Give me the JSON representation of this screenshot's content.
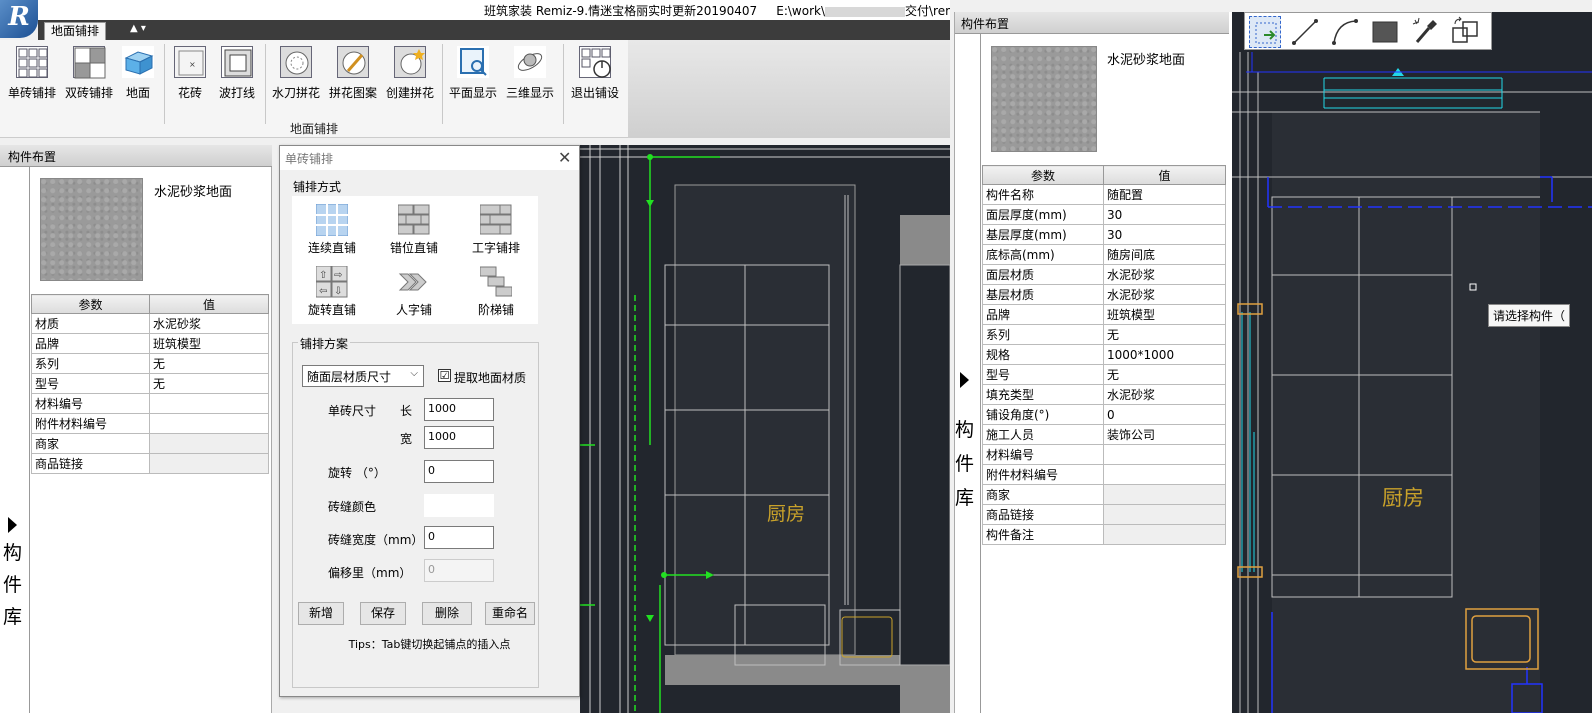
{
  "window": {
    "title_left": "班筑家装 Remiz-9.情迷宝格丽实时更新20190407",
    "title_path_start": "E:\\work\\",
    "title_path_end": "交付\\remiz",
    "logo_text": "R"
  },
  "ribbon": {
    "active_tab": "地面铺排",
    "group_label": "地面铺排",
    "buttons": [
      {
        "label": "单砖铺排"
      },
      {
        "label": "双砖铺排"
      },
      {
        "label": "地面"
      },
      {
        "label": "花砖"
      },
      {
        "label": "波打线"
      },
      {
        "label": "水刀拼花"
      },
      {
        "label": "拼花图案"
      },
      {
        "label": "创建拼花"
      },
      {
        "label": "平面显示"
      },
      {
        "label": "三维显示"
      },
      {
        "label": "退出铺设"
      }
    ]
  },
  "left_panel": {
    "header": "构件布置",
    "library_label": [
      "构",
      "件",
      "库"
    ],
    "material_name": "水泥砂浆地面",
    "table_headers": [
      "参数",
      "值"
    ],
    "rows": [
      {
        "param": "材质",
        "value": "水泥砂浆"
      },
      {
        "param": "品牌",
        "value": "班筑模型"
      },
      {
        "param": "系列",
        "value": "无"
      },
      {
        "param": "型号",
        "value": "无"
      },
      {
        "param": "材料编号",
        "value": ""
      },
      {
        "param": "附件材料编号",
        "value": ""
      },
      {
        "param": "商家",
        "value": ""
      },
      {
        "param": "商品链接",
        "value": ""
      }
    ]
  },
  "dialog": {
    "title": "单砖铺排",
    "method_label": "铺排方式",
    "methods": [
      {
        "label": "连续直铺"
      },
      {
        "label": "错位直铺"
      },
      {
        "label": "工字铺排"
      },
      {
        "label": "旋转直铺"
      },
      {
        "label": "人字铺"
      },
      {
        "label": "阶梯铺"
      }
    ],
    "plan_label": "铺排方案",
    "size_option": "随面层材质尺寸",
    "extract_label": "提取地面材质",
    "extract_checked": "☑",
    "tile_size_label": "单砖尺寸",
    "length_label": "长",
    "length_value": "1000",
    "width_label": "宽",
    "width_value": "1000",
    "rotate_label": "旋转 （°）",
    "rotate_value": "0",
    "joint_color_label": "砖缝颜色",
    "joint_width_label": "砖缝宽度（mm）",
    "joint_width_value": "0",
    "offset_label": "偏移里（mm）",
    "offset_value": "0",
    "buttons": {
      "add": "新增",
      "save": "保存",
      "delete": "删除",
      "rename": "重命名"
    },
    "tips": "Tips：Tab键切换起铺点的插入点"
  },
  "cad": {
    "room_label": "厨房",
    "tooltip": "请选择构件（"
  },
  "right_panel": {
    "header": "构件布置",
    "library_label": [
      "构",
      "件",
      "库"
    ],
    "material_name": "水泥砂浆地面",
    "table_headers": [
      "参数",
      "值"
    ],
    "rows": [
      {
        "param": "构件名称",
        "value": "随配置"
      },
      {
        "param": "面层厚度(mm)",
        "value": "30"
      },
      {
        "param": "基层厚度(mm)",
        "value": "30"
      },
      {
        "param": "底标高(mm)",
        "value": "随房间底"
      },
      {
        "param": "面层材质",
        "value": "水泥砂浆"
      },
      {
        "param": "基层材质",
        "value": "水泥砂浆"
      },
      {
        "param": "品牌",
        "value": "班筑模型"
      },
      {
        "param": "系列",
        "value": "无"
      },
      {
        "param": "规格",
        "value": "1000*1000"
      },
      {
        "param": "型号",
        "value": "无"
      },
      {
        "param": "填充类型",
        "value": "水泥砂浆"
      },
      {
        "param": "铺设角度(°)",
        "value": "0"
      },
      {
        "param": "施工人员",
        "value": "装饰公司"
      },
      {
        "param": "材料编号",
        "value": ""
      },
      {
        "param": "附件材料编号",
        "value": ""
      },
      {
        "param": "商家",
        "value": ""
      },
      {
        "param": "商品链接",
        "value": ""
      },
      {
        "param": "构件备注",
        "value": ""
      }
    ]
  },
  "colors": {
    "cad_bg": "#22262d",
    "cad_green": "#22e022",
    "cad_cyan": "#22d8e8",
    "cad_blue": "#2233ff",
    "room_text": "#c9a22a"
  }
}
